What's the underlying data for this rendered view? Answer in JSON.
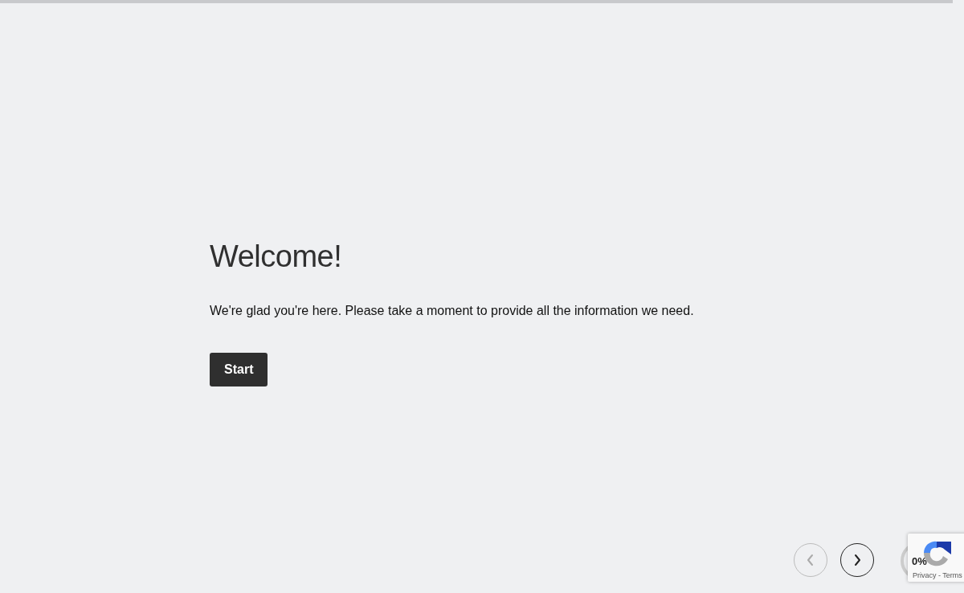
{
  "progress_bar": {
    "level": 0
  },
  "title": "Welcome!",
  "intro": "We're glad you're here. Please take a moment to provide all the information we need.",
  "start_button": "Start",
  "navigation": [
    {
      "kind": "previous",
      "disabled": true
    },
    {
      "kind": "next",
      "disabled": false
    }
  ],
  "progress_percent": "0%",
  "recaptcha": {
    "links": "Privacy - Terms"
  }
}
